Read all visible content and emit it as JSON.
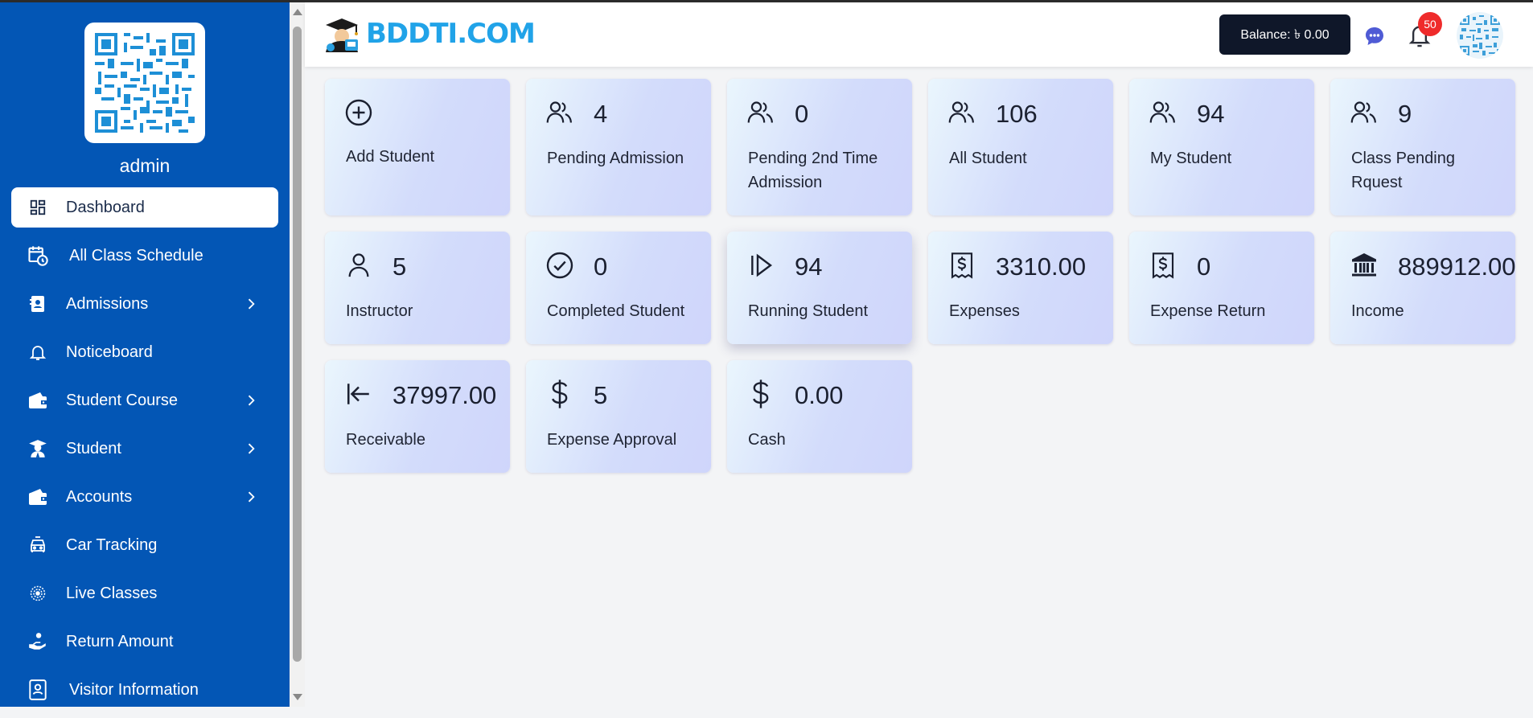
{
  "app": {
    "brand": "BDDTI.COM",
    "user_name": "admin"
  },
  "header": {
    "balance_label": "Balance: ৳ 0.00",
    "notification_count": "50"
  },
  "sidebar": {
    "items": [
      {
        "label": "Dashboard",
        "icon": "dashboard-grid-icon",
        "active": true,
        "has_submenu": false
      },
      {
        "label": "All Class Schedule",
        "icon": "calendar-clock-icon",
        "active": false,
        "has_submenu": false
      },
      {
        "label": "Admissions",
        "icon": "contact-card-icon",
        "active": false,
        "has_submenu": true
      },
      {
        "label": "Noticeboard",
        "icon": "bell-icon",
        "active": false,
        "has_submenu": false
      },
      {
        "label": "Student Course",
        "icon": "wallet-icon",
        "active": false,
        "has_submenu": true
      },
      {
        "label": "Student",
        "icon": "graduate-icon",
        "active": false,
        "has_submenu": true
      },
      {
        "label": "Accounts",
        "icon": "wallet-icon",
        "active": false,
        "has_submenu": true
      },
      {
        "label": "Car Tracking",
        "icon": "car-icon",
        "active": false,
        "has_submenu": false
      },
      {
        "label": "Live Classes",
        "icon": "live-broadcast-icon",
        "active": false,
        "has_submenu": false
      },
      {
        "label": "Return Amount",
        "icon": "hand-coin-icon",
        "active": false,
        "has_submenu": false
      },
      {
        "label": "Visitor Information",
        "icon": "visitor-book-icon",
        "active": false,
        "has_submenu": false
      }
    ]
  },
  "cards": [
    {
      "value": "",
      "label": "Add Student",
      "icon": "plus-circle-icon"
    },
    {
      "value": "4",
      "label": "Pending Admission",
      "icon": "users-icon"
    },
    {
      "value": "0",
      "label": "Pending 2nd Time Admission",
      "icon": "users-icon"
    },
    {
      "value": "106",
      "label": "All Student",
      "icon": "users-icon"
    },
    {
      "value": "94",
      "label": "My Student",
      "icon": "users-icon"
    },
    {
      "value": "9",
      "label": "Class Pending Rquest",
      "icon": "users-icon"
    },
    {
      "value": "5",
      "label": "Instructor",
      "icon": "user-icon"
    },
    {
      "value": "0",
      "label": "Completed Student",
      "icon": "check-circle-icon"
    },
    {
      "value": "94",
      "label": "Running Student",
      "icon": "play-icon"
    },
    {
      "value": "3310.00",
      "label": "Expenses",
      "icon": "receipt-icon"
    },
    {
      "value": "0",
      "label": "Expense Return",
      "icon": "receipt-icon"
    },
    {
      "value": "889912.00",
      "label": "Income",
      "icon": "bank-icon"
    },
    {
      "value": "37997.00",
      "label": "Receivable",
      "icon": "arrow-left-bar-icon"
    },
    {
      "value": "5",
      "label": "Expense Approval",
      "icon": "dollar-icon"
    },
    {
      "value": "0.00",
      "label": "Cash",
      "icon": "dollar-icon"
    }
  ],
  "colors": {
    "sidebar_bg": "#0356b5",
    "brand_blue": "#21a3e8",
    "balance_bg": "#0f1729",
    "badge_red": "#ef2b2b"
  }
}
